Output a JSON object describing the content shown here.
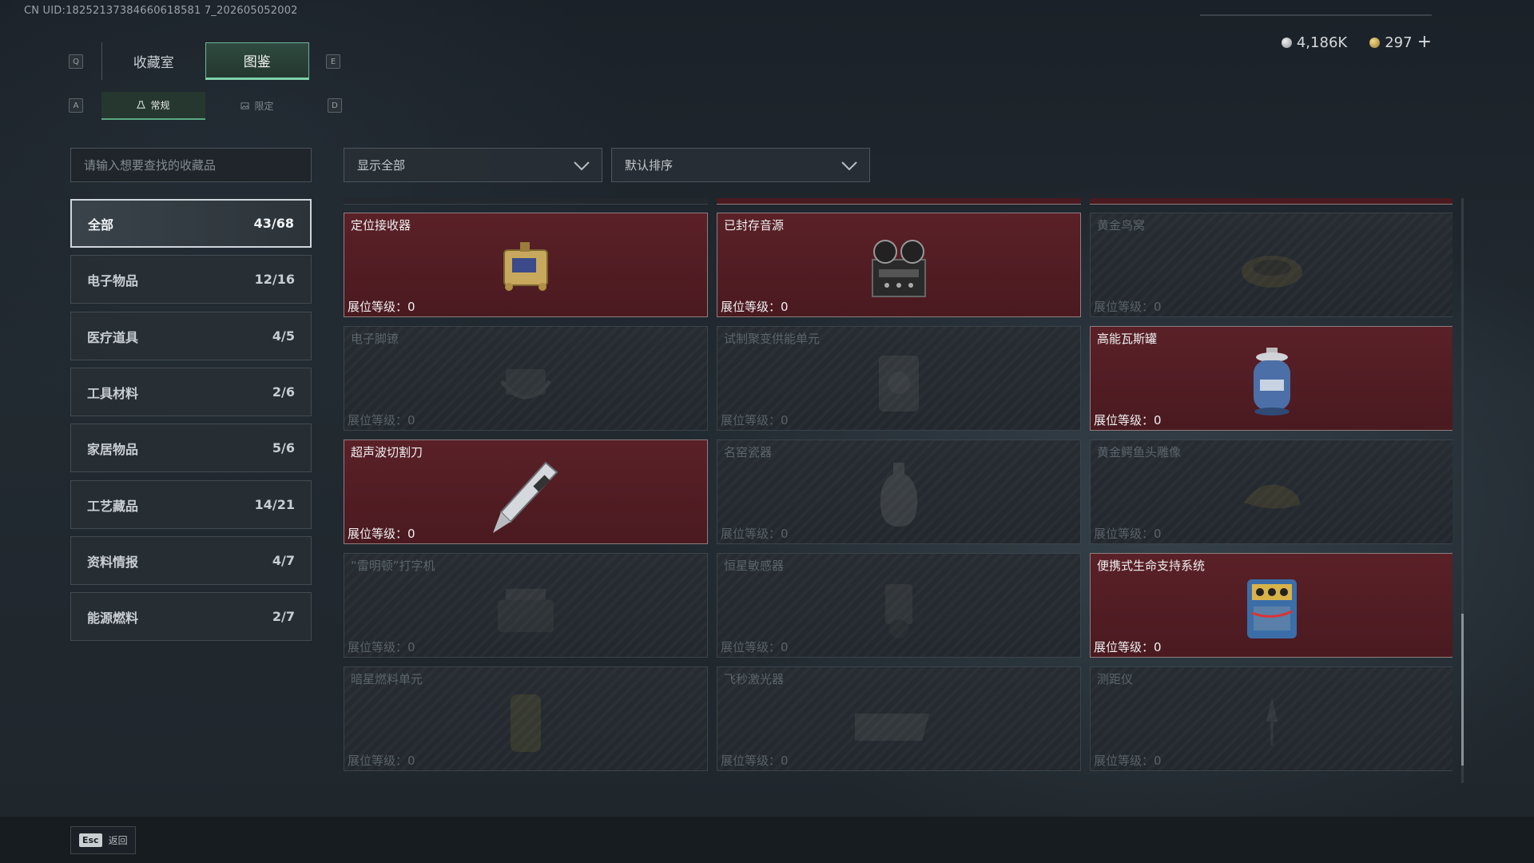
{
  "uid": "CN UID:18252137384660618581 7_202605052002",
  "tabs": {
    "key_left": "Q",
    "key_right": "E",
    "items": [
      "收藏室",
      "图鉴"
    ],
    "active": 1
  },
  "subtabs": {
    "key_left": "A",
    "key_right": "D",
    "items": [
      "常规",
      "限定"
    ],
    "active": 0
  },
  "currency": {
    "silver": "4,186K",
    "gold": "297",
    "plus": "+"
  },
  "search": {
    "placeholder": "请输入想要查找的收藏品"
  },
  "filters": {
    "show": "显示全部",
    "sort": "默认排序"
  },
  "sidebar": [
    {
      "label": "全部",
      "count": "43/68"
    },
    {
      "label": "电子物品",
      "count": "12/16"
    },
    {
      "label": "医疗道具",
      "count": "4/5"
    },
    {
      "label": "工具材料",
      "count": "2/6"
    },
    {
      "label": "家居物品",
      "count": "5/6"
    },
    {
      "label": "工艺藏品",
      "count": "14/21"
    },
    {
      "label": "资料情报",
      "count": "4/7"
    },
    {
      "label": "能源燃料",
      "count": "2/7"
    }
  ],
  "level_label": "展位等级：",
  "items": [
    {
      "name": "定位接收器",
      "level": "0",
      "owned": true,
      "icon": "gps-receiver-icon"
    },
    {
      "name": "已封存音源",
      "level": "0",
      "owned": true,
      "icon": "reel-recorder-icon"
    },
    {
      "name": "黄金鸟窝",
      "level": "0",
      "owned": false,
      "icon": "golden-nest-icon"
    },
    {
      "name": "电子脚镣",
      "level": "0",
      "owned": false,
      "icon": "ankle-monitor-icon"
    },
    {
      "name": "试制聚变供能单元",
      "level": "0",
      "owned": false,
      "icon": "fusion-unit-icon"
    },
    {
      "name": "高能瓦斯罐",
      "level": "0",
      "owned": true,
      "icon": "gas-canister-icon"
    },
    {
      "name": "超声波切割刀",
      "level": "0",
      "owned": true,
      "icon": "ultrasonic-cutter-icon"
    },
    {
      "name": "名窑瓷器",
      "level": "0",
      "owned": false,
      "icon": "porcelain-vase-icon"
    },
    {
      "name": "黄金鳄鱼头雕像",
      "level": "0",
      "owned": false,
      "icon": "croc-statue-icon"
    },
    {
      "name": "“雷明顿”打字机",
      "level": "0",
      "owned": false,
      "icon": "typewriter-icon"
    },
    {
      "name": "恒星敏感器",
      "level": "0",
      "owned": false,
      "icon": "star-sensor-icon"
    },
    {
      "name": "便携式生命支持系统",
      "level": "0",
      "owned": true,
      "icon": "life-support-icon"
    },
    {
      "name": "暗星燃料单元",
      "level": "0",
      "owned": false,
      "icon": "fuel-cell-icon"
    },
    {
      "name": "飞秒激光器",
      "level": "0",
      "owned": false,
      "icon": "laser-device-icon"
    },
    {
      "name": "测距仪",
      "level": "0",
      "owned": false,
      "icon": "rangefinder-icon"
    }
  ],
  "partial_row": [
    {
      "owned": false
    },
    {
      "owned": true
    },
    {
      "owned": true
    }
  ],
  "footer": {
    "key": "Esc",
    "label": "返回"
  },
  "colors": {
    "owned_bg": "#4a1a20",
    "locked_bg": "#22282d",
    "accent_green": "#7fd3a8"
  }
}
